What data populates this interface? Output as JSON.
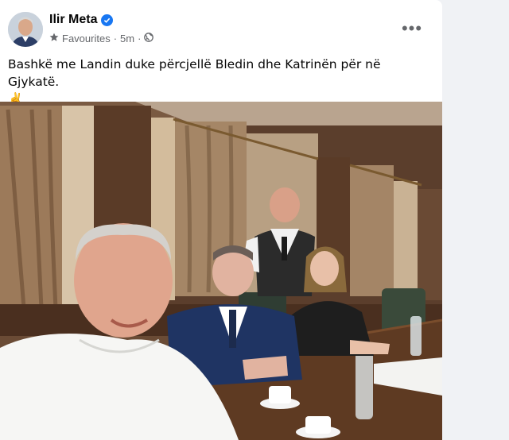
{
  "post": {
    "author_name": "Ilir Meta",
    "verified": true,
    "audience_label": "Favourites",
    "separator": "·",
    "timestamp": "5m",
    "privacy_icon": "globe-icon",
    "text": "Bashkë me Landin duke përcjellë Bledin dhe Katrinën për në Gjykatë.",
    "emoji": "✌️",
    "more_icon": "more-options-icon",
    "more_label": "•••"
  },
  "colors": {
    "verified_badge": "#1877f2",
    "secondary_text": "#65676b",
    "primary_text": "#050505"
  }
}
